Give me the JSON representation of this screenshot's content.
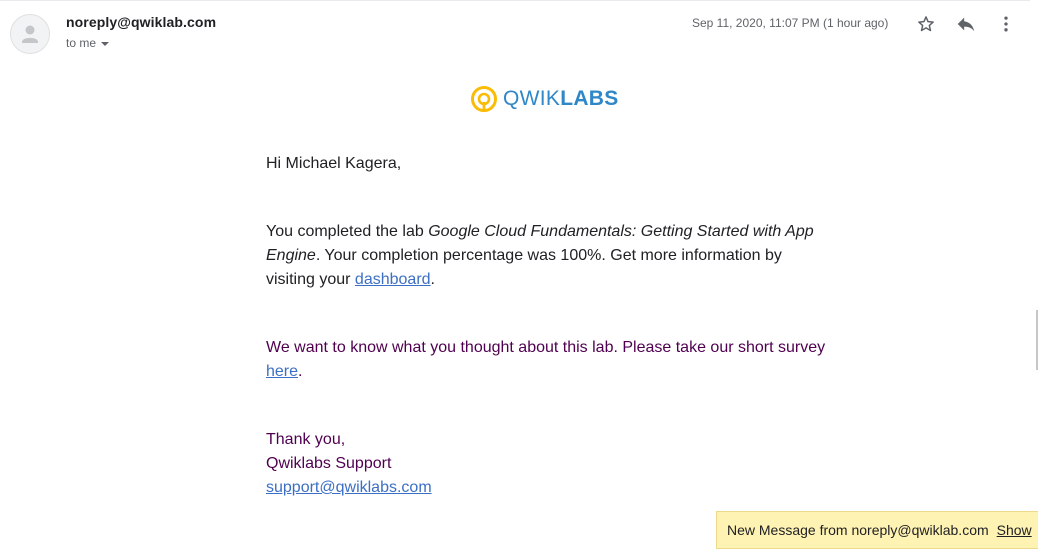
{
  "header": {
    "sender": "noreply@qwiklab.com",
    "recipient_label": "to me",
    "date": "Sep 11, 2020, 11:07 PM (1 hour ago)",
    "icons": [
      "avatar-icon",
      "star-icon",
      "reply-icon",
      "more-vert-icon"
    ]
  },
  "logo": {
    "text_light": "QWIK",
    "text_bold": "LABS",
    "accent_color": "#fbbc05",
    "brand_color": "#2f87c8"
  },
  "message": {
    "greeting": "Hi Michael Kagera,",
    "para1_prefix": "You completed the lab ",
    "lab_name": "Google Cloud Fundamentals: Getting Started with App Engine",
    "para1_middle": ". Your completion percentage was 100%. Get more information by visiting your ",
    "dashboard_link": "dashboard",
    "para1_suffix": ".",
    "para2_prefix": "We want to know what you thought about this lab. Please take our short survey ",
    "survey_link": "here",
    "para2_suffix": ".",
    "closing_line1": "Thank you,",
    "closing_line2": "Qwiklabs Support",
    "support_email": "support@qwiklabs.com"
  },
  "notification": {
    "text": "New Message from noreply@qwiklab.com",
    "action": "Show"
  }
}
